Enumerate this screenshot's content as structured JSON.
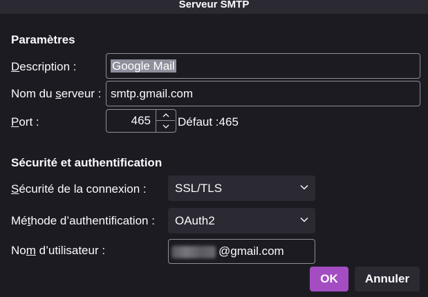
{
  "window": {
    "title": "Serveur SMTP"
  },
  "settings": {
    "heading": "Paramètres",
    "description": {
      "label_u": "D",
      "label_rest": "escription :",
      "value": "Google Mail"
    },
    "server": {
      "label_pre": "Nom du ",
      "label_u": "s",
      "label_post": "erveur :",
      "value": "smtp.gmail.com"
    },
    "port": {
      "label_u": "P",
      "label_rest": "ort :",
      "value": "465",
      "default_text": "Défaut :465"
    }
  },
  "security": {
    "heading": "Sécurité et authentification",
    "connection": {
      "label_u": "S",
      "label_rest": "écurité de la connexion :",
      "value": "SSL/TLS"
    },
    "auth": {
      "label_pre": "Mé",
      "label_u": "t",
      "label_post": "hode d’authentification :",
      "value": "OAuth2"
    },
    "username": {
      "label_pre": "No",
      "label_u": "m",
      "label_post": " d’utilisateur :",
      "value_suffix": "@gmail.com"
    }
  },
  "buttons": {
    "ok": "OK",
    "cancel": "Annuler"
  },
  "colors": {
    "accent": "#a44dc2",
    "background": "#1c1b22",
    "border": "#8f8f9d"
  }
}
